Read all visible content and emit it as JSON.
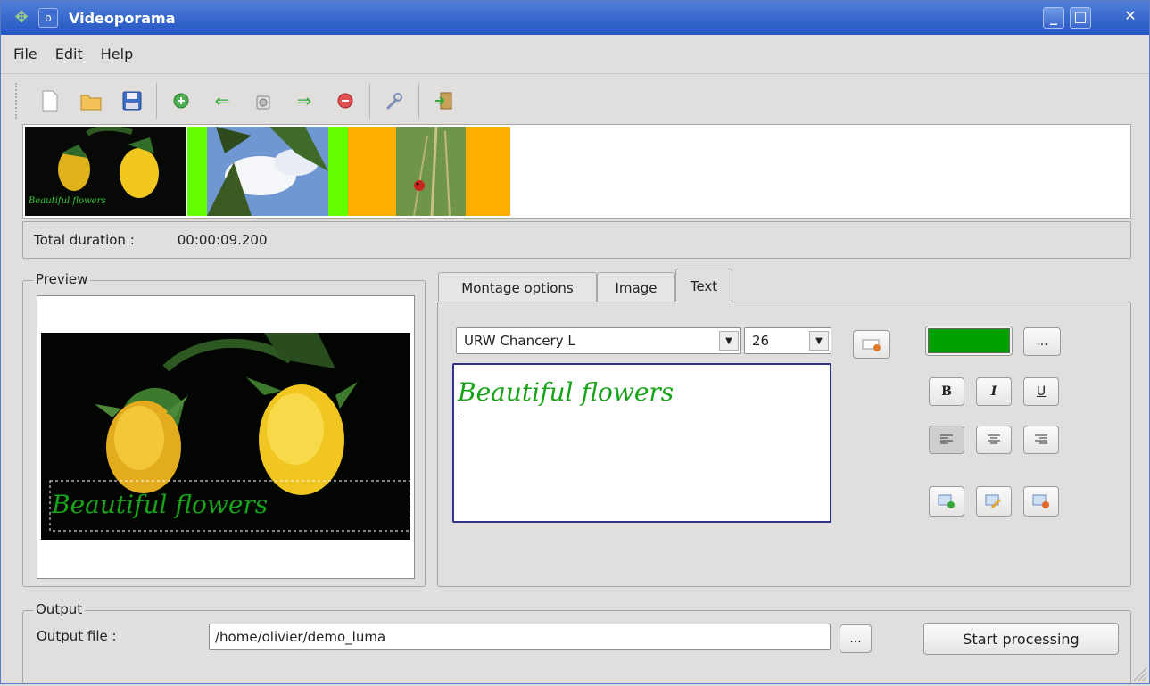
{
  "window": {
    "title": "Videoporama"
  },
  "menu": [
    "File",
    "Edit",
    "Help"
  ],
  "toolbar": {
    "icons": [
      "new-file-icon",
      "open-folder-icon",
      "save-icon",
      "add-icon",
      "move-left-icon",
      "camera-icon",
      "move-right-icon",
      "remove-icon",
      "settings-wrench-icon",
      "exit-icon"
    ]
  },
  "timeline": {
    "thumbnails": [
      {
        "name": "roses",
        "caption": "Beautiful flowers"
      },
      {
        "name": "sky-tree"
      },
      {
        "name": "ladybug"
      }
    ],
    "colors": {
      "transition_green": "#66ff00",
      "transition_orange": "#ffae00"
    }
  },
  "duration": {
    "label": "Total duration :",
    "value": "00:00:09.200"
  },
  "preview": {
    "label": "Preview",
    "caption": "Beautiful flowers"
  },
  "tabs": [
    {
      "label": "Montage options",
      "active": false
    },
    {
      "label": "Image",
      "active": false
    },
    {
      "label": "Text",
      "active": true
    }
  ],
  "text_tab": {
    "font": "URW Chancery L",
    "size": "26",
    "content": "Beautiful flowers",
    "color": "#00a000",
    "color_button": "...",
    "style_buttons": [
      "B",
      "I",
      "U"
    ],
    "align_icons": [
      "align-left-icon",
      "align-center-icon",
      "align-right-icon"
    ],
    "action_icons": [
      "add-text-icon",
      "edit-text-icon",
      "remove-text-icon"
    ]
  },
  "output": {
    "label": "Output",
    "file_label": "Output file :",
    "file_value": "/home/olivier/demo_luma",
    "browse_label": "...",
    "start_label": "Start processing"
  }
}
